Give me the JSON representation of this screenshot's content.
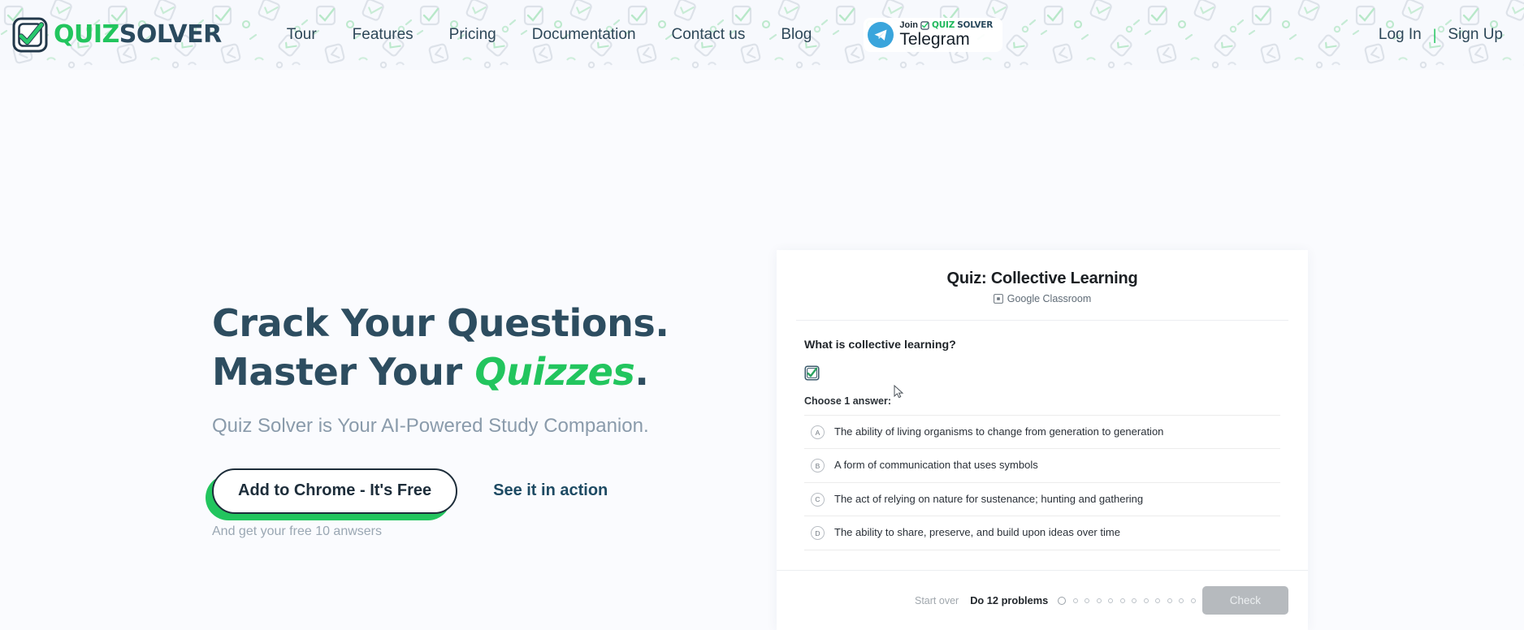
{
  "brand": {
    "logo_icon": "quizsolver-checkbox-logo-icon",
    "name_part1": "QUIZ",
    "name_part2": "SOLVER",
    "green": "#22c55e",
    "navy": "#2a4a5e"
  },
  "header": {
    "nav": [
      {
        "label": "Tour",
        "name": "nav-link-tour"
      },
      {
        "label": "Features",
        "name": "nav-link-features"
      },
      {
        "label": "Pricing",
        "name": "nav-link-pricing"
      },
      {
        "label": "Documentation",
        "name": "nav-link-documentation"
      },
      {
        "label": "Contact us",
        "name": "nav-link-contact-us"
      },
      {
        "label": "Blog",
        "name": "nav-link-blog"
      }
    ],
    "telegram": {
      "icon": "telegram-paper-plane-icon",
      "join_label": "Join",
      "brand_quiz": "QUIZ",
      "brand_solver": "SOLVER",
      "name": "Telegram"
    },
    "auth": {
      "login": "Log In",
      "separator": "|",
      "signup": "Sign Up"
    }
  },
  "hero": {
    "title_line1": "Crack Your Questions.",
    "title_line2_prefix": "Master Your ",
    "title_line2_accent": "Quizzes",
    "title_line2_suffix": ".",
    "subtitle": "Quiz Solver is Your AI-Powered Study Companion.",
    "cta_primary": "Add to Chrome - It's Free",
    "cta_secondary": "See it in action",
    "cta_note": "And get your free 10 anwsers"
  },
  "quiz_mock": {
    "title": "Quiz: Collective Learning",
    "source_icon": "google-classroom-icon",
    "source": "Google Classroom",
    "question": "What is collective learning?",
    "badge_icon": "quizsolver-checkbox-badge-icon",
    "choose_label": "Choose 1 answer:",
    "cursor_icon": "mouse-cursor-icon",
    "answers": [
      {
        "letter": "A",
        "text": "The ability of living organisms to change from generation to generation"
      },
      {
        "letter": "B",
        "text": "A form of communication that uses symbols"
      },
      {
        "letter": "C",
        "text": "The act of relying on nature for sustenance; hunting and gathering"
      },
      {
        "letter": "D",
        "text": "The ability to share, preserve, and build upon ideas over time"
      }
    ],
    "footer": {
      "start_over": "Start over",
      "do_problems": "Do 12 problems",
      "dot_count": 12,
      "active_dot_index": 0,
      "check_label": "Check"
    }
  }
}
